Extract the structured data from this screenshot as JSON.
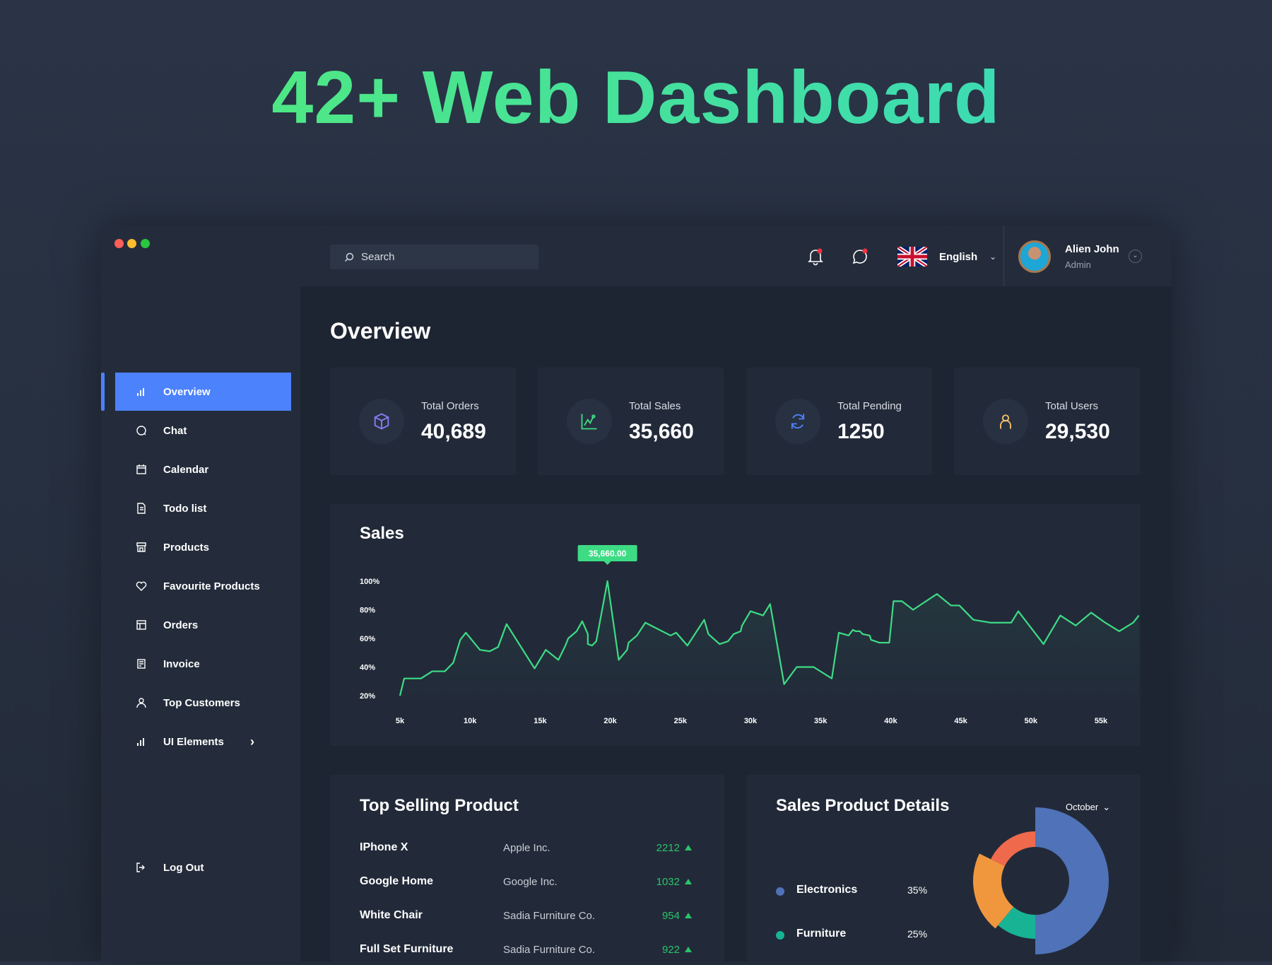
{
  "hero_title": "42+ Web Dashboard",
  "header": {
    "search_placeholder": "Search",
    "language": "English",
    "user_name": "Alien John",
    "user_role": "Admin"
  },
  "sidebar": {
    "items": [
      {
        "label": "Overview",
        "icon": "bar-chart-icon",
        "active": true
      },
      {
        "label": "Chat",
        "icon": "chat-icon"
      },
      {
        "label": "Calendar",
        "icon": "calendar-icon"
      },
      {
        "label": "Todo list",
        "icon": "document-icon"
      },
      {
        "label": "Products",
        "icon": "store-icon"
      },
      {
        "label": "Favourite Products",
        "icon": "heart-icon"
      },
      {
        "label": "Orders",
        "icon": "table-icon"
      },
      {
        "label": "Invoice",
        "icon": "invoice-icon"
      },
      {
        "label": "Top Customers",
        "icon": "user-icon"
      },
      {
        "label": "UI Elements",
        "icon": "bar-chart-icon",
        "has_submenu": true
      }
    ],
    "logout": "Log Out"
  },
  "page_title": "Overview",
  "stats": [
    {
      "label": "Total Orders",
      "value": "40,689",
      "icon": "box-icon",
      "color": "#8a7cf7"
    },
    {
      "label": "Total Sales",
      "value": "35,660",
      "icon": "line-chart-icon",
      "color": "#3ddc84"
    },
    {
      "label": "Total Pending",
      "value": "1250",
      "icon": "refresh-icon",
      "color": "#4c82fb"
    },
    {
      "label": "Total Users",
      "value": "29,530",
      "icon": "user-icon",
      "color": "#f7c06a"
    }
  ],
  "sales": {
    "title": "Sales",
    "tooltip": "35,660.00"
  },
  "chart_data": {
    "type": "line",
    "title": "Sales",
    "color": "#3ddc84",
    "x_ticks": [
      "5k",
      "10k",
      "15k",
      "20k",
      "25k",
      "30k",
      "35k",
      "40k",
      "45k",
      "50k",
      "55k"
    ],
    "y_ticks": [
      "100%",
      "80%",
      "60%",
      "40%",
      "20%"
    ],
    "xlim": [
      5,
      58
    ],
    "ylim": [
      20,
      100
    ],
    "points": [
      [
        5,
        20
      ],
      [
        5.3,
        32
      ],
      [
        6.5,
        32
      ],
      [
        7.3,
        37
      ],
      [
        8.2,
        37
      ],
      [
        8.8,
        43
      ],
      [
        9.3,
        59
      ],
      [
        9.7,
        64
      ],
      [
        10.7,
        52
      ],
      [
        11.4,
        51
      ],
      [
        12,
        54
      ],
      [
        12.6,
        70
      ],
      [
        14.6,
        39
      ],
      [
        15.4,
        52
      ],
      [
        16.3,
        45
      ],
      [
        16.8,
        55
      ],
      [
        17,
        60
      ],
      [
        17.6,
        65
      ],
      [
        18,
        72
      ],
      [
        18.4,
        63
      ],
      [
        18.4,
        56
      ],
      [
        18.7,
        55
      ],
      [
        19,
        58
      ],
      [
        19.8,
        100
      ],
      [
        20.6,
        45
      ],
      [
        21.2,
        52
      ],
      [
        21.3,
        57
      ],
      [
        21.9,
        62
      ],
      [
        22.5,
        71
      ],
      [
        24.3,
        62
      ],
      [
        24.7,
        64
      ],
      [
        25.5,
        55
      ],
      [
        26.7,
        73
      ],
      [
        27,
        63
      ],
      [
        27.8,
        56
      ],
      [
        28.4,
        58
      ],
      [
        28.8,
        63
      ],
      [
        29.3,
        65
      ],
      [
        29.4,
        69
      ],
      [
        30,
        79
      ],
      [
        30.9,
        76
      ],
      [
        31.4,
        84
      ],
      [
        32.4,
        28
      ],
      [
        33.3,
        40
      ],
      [
        34.5,
        40
      ],
      [
        35.8,
        32
      ],
      [
        36.3,
        64
      ],
      [
        37,
        62
      ],
      [
        37.3,
        66
      ],
      [
        37.5,
        65
      ],
      [
        37.8,
        65
      ],
      [
        38,
        63
      ],
      [
        38.5,
        62
      ],
      [
        38.6,
        59
      ],
      [
        39.2,
        57
      ],
      [
        39.9,
        57
      ],
      [
        40.2,
        86
      ],
      [
        40.8,
        86
      ],
      [
        41.6,
        80
      ],
      [
        43.3,
        91
      ],
      [
        44.3,
        83
      ],
      [
        44.9,
        83
      ],
      [
        45.9,
        73
      ],
      [
        47.1,
        71
      ],
      [
        48.6,
        71
      ],
      [
        49.1,
        79
      ],
      [
        50.9,
        56
      ],
      [
        52.1,
        76
      ],
      [
        53.2,
        69
      ],
      [
        54.3,
        78
      ],
      [
        55.3,
        71
      ],
      [
        56.3,
        65
      ],
      [
        57.3,
        71
      ],
      [
        57.7,
        76
      ]
    ],
    "highlight": {
      "x": 19.8,
      "y": 100,
      "label": "35,660.00"
    }
  },
  "top_selling": {
    "title": "Top Selling Product",
    "rows": [
      {
        "product": "IPhone X",
        "company": "Apple Inc.",
        "value": "2212"
      },
      {
        "product": "Google Home",
        "company": "Google Inc.",
        "value": "1032"
      },
      {
        "product": "White Chair",
        "company": "Sadia Furniture Co.",
        "value": "954"
      },
      {
        "product": "Full Set Furniture",
        "company": "Sadia Furniture Co.",
        "value": "922"
      }
    ]
  },
  "sales_details": {
    "title": "Sales Product Details",
    "month": "October",
    "legend": [
      {
        "label": "Electronics",
        "pct": "35%",
        "color": "#4f72b8"
      },
      {
        "label": "Furniture",
        "pct": "25%",
        "color": "#17b394"
      }
    ]
  }
}
